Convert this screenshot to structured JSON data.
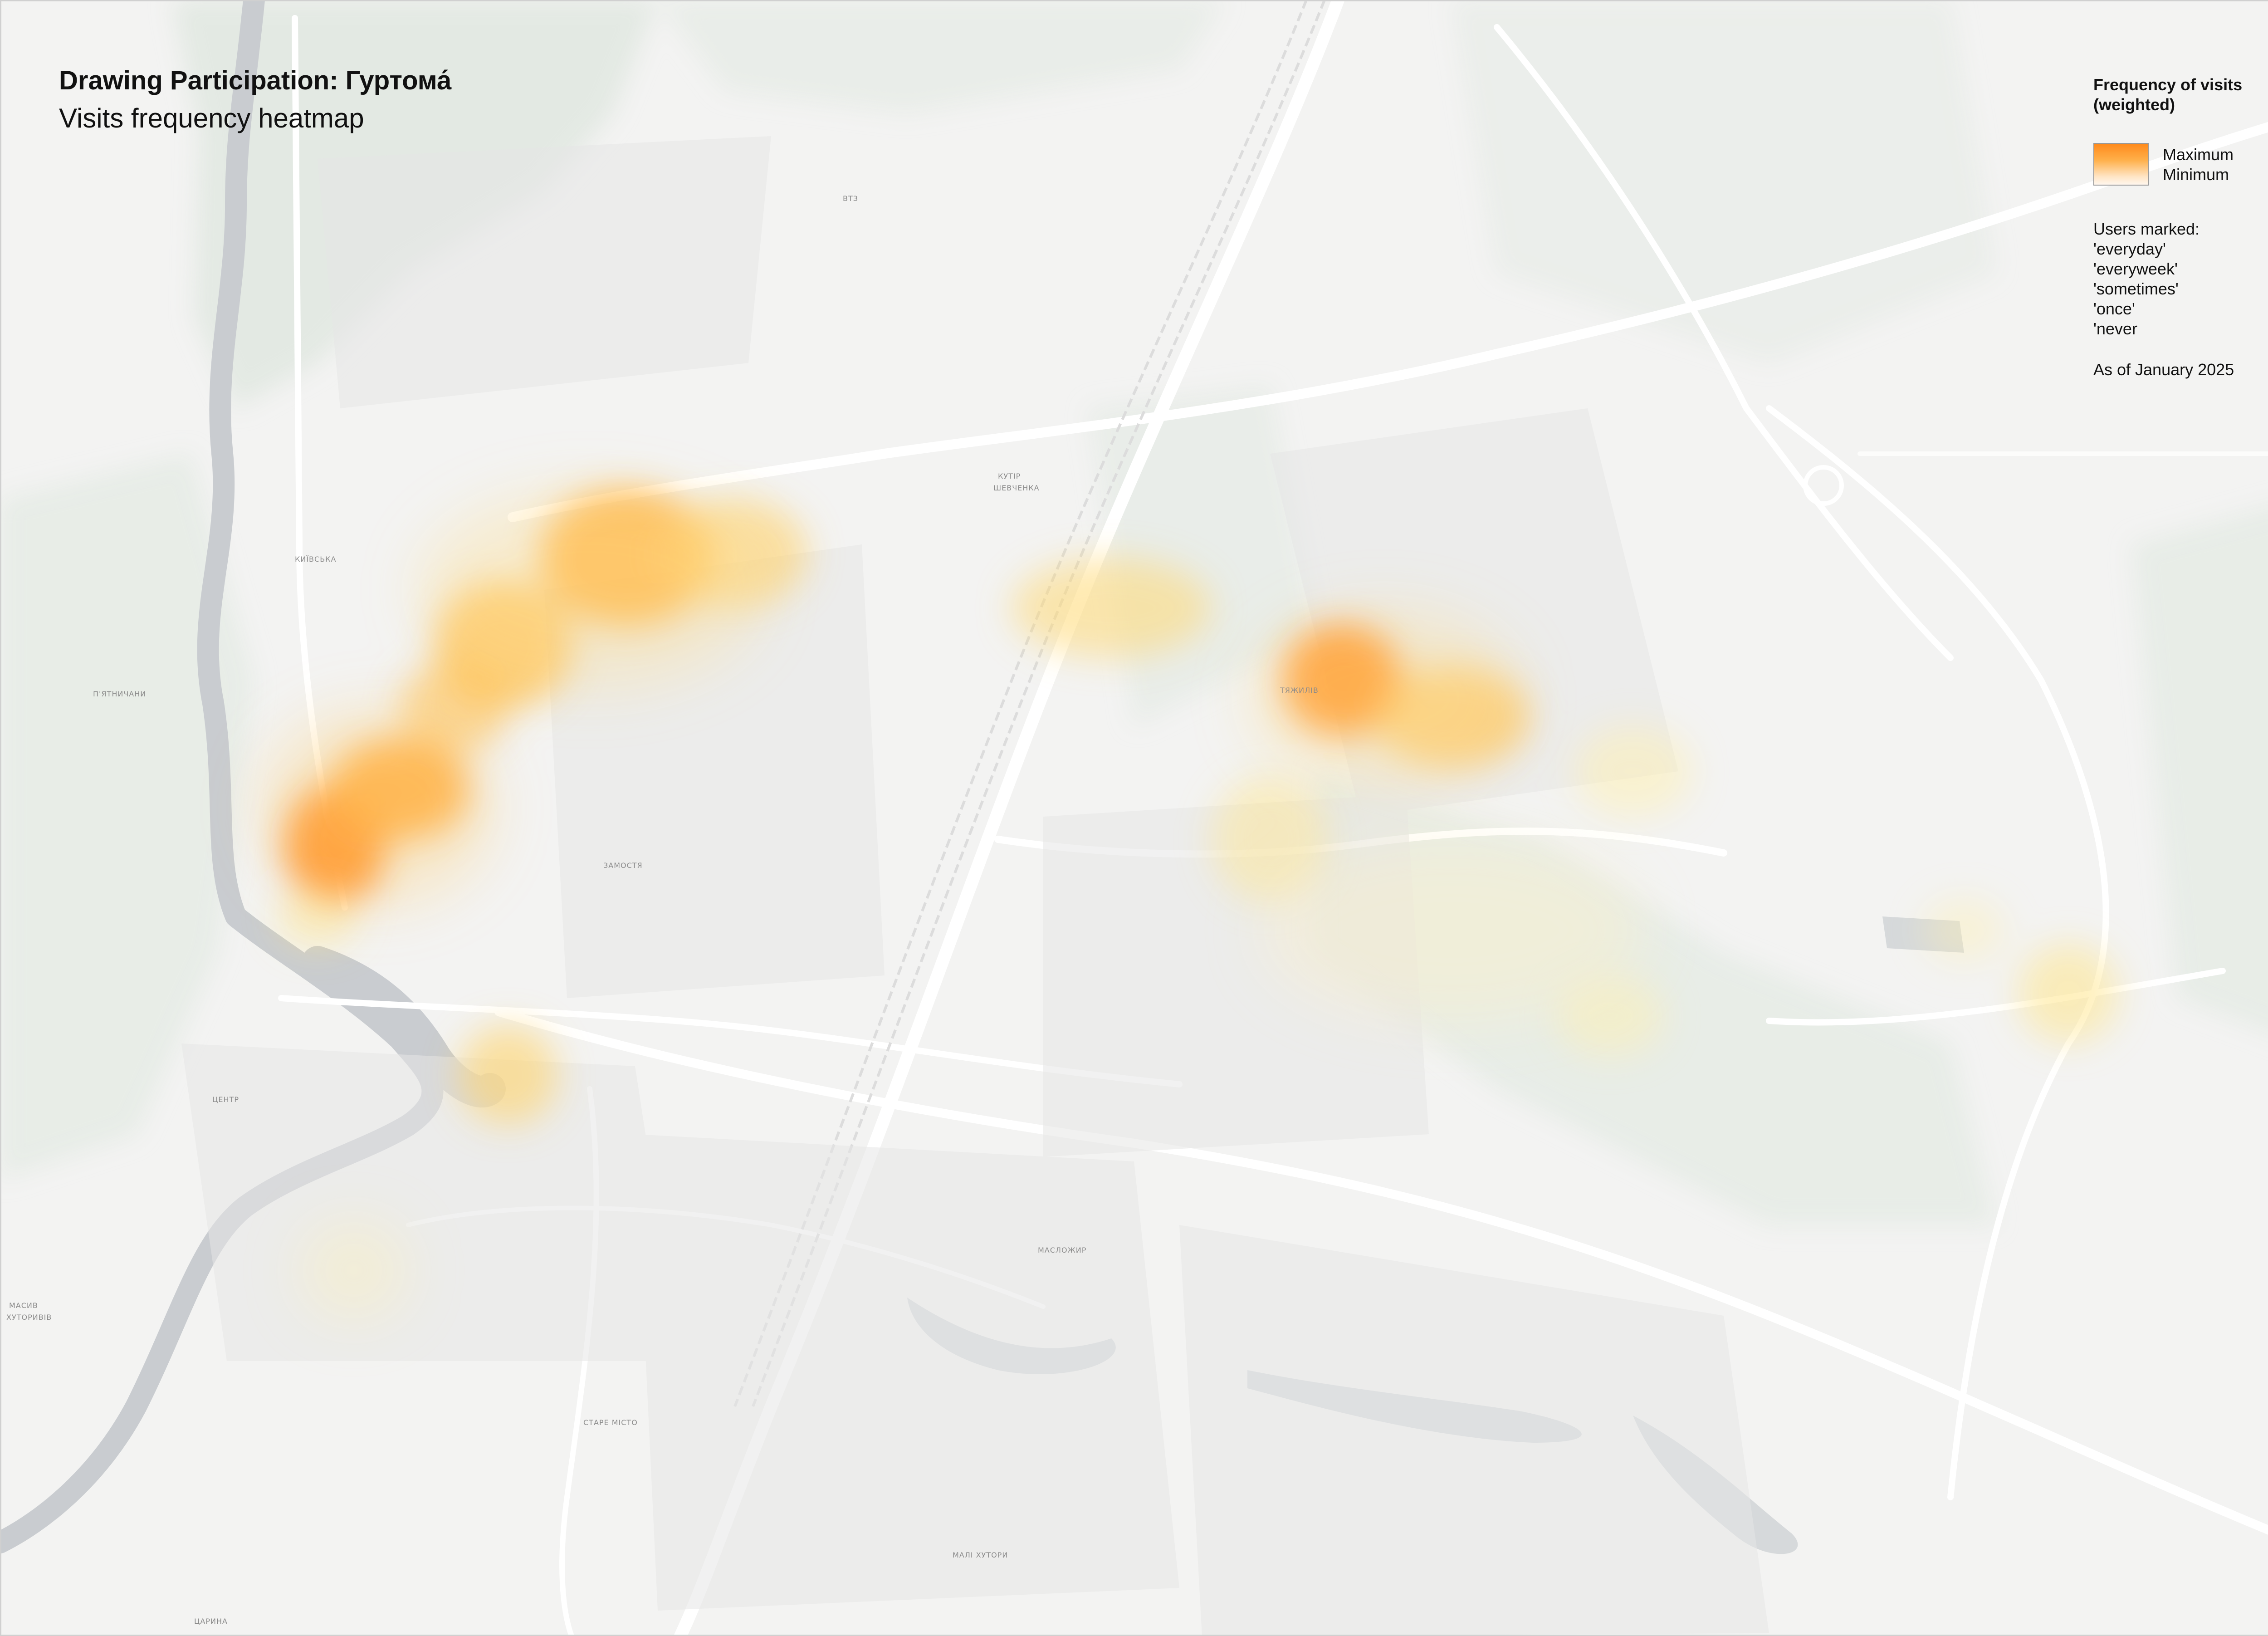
{
  "title": "Drawing Participation: Гуртома́",
  "subtitle": "Visits frequency heatmap",
  "legend": {
    "heading_line1": "Frequency of visits",
    "heading_line2": "(weighted)",
    "max_label": "Maximum",
    "min_label": "Minimum",
    "gradient_colors": [
      "#ff8a1c",
      "#ffe4c4"
    ],
    "users_heading": "Users marked:",
    "categories": [
      "'everyday'",
      "'everyweek'",
      "'sometimes'",
      "'once'",
      "'never"
    ],
    "as_of": "As of January 2025"
  },
  "map_labels": {
    "kyivska": "КИЇВСЬКА",
    "piatnychany": "П'ЯТНИЧАНИ",
    "zamostia": "ЗАМОСТЯ",
    "tsentr": "ЦЕНТР",
    "stare_misto": "СТАРЕ МІСТО",
    "masloshyr": "МАСЛОЖИР",
    "mali_khutory": "МАЛІ ХУТОРИ",
    "kutir_shevchenka_1": "КУТІР",
    "kutir_shevchenka_2": "ШЕВЧЕНКА",
    "tiazhylo": "ТЯЖИЛІВ",
    "vtz": "ВТЗ",
    "masiv_1": "МАСИВ",
    "masiv_2": "ХУТОРИВІВ",
    "saryna": "ЦАРИНА"
  },
  "colors": {
    "background": "#f3f3f2",
    "river": "#c9ccd0",
    "parks": "#e3e9e3",
    "heat_max": "#ff8a1c",
    "heat_mid": "#ffb94a",
    "heat_min": "#ffe58a"
  }
}
